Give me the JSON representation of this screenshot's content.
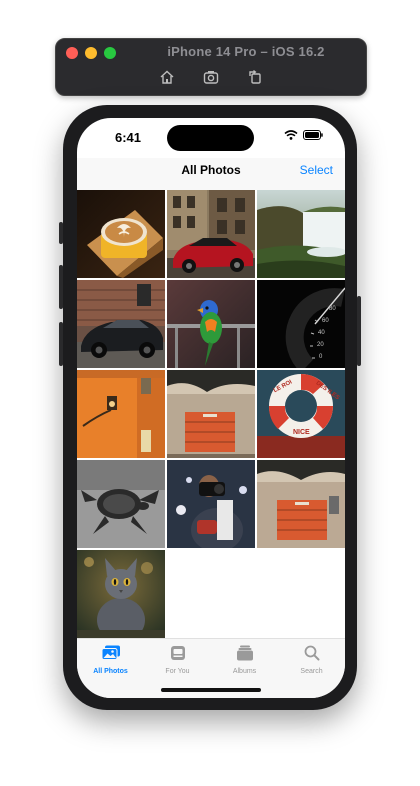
{
  "simulator": {
    "title": "iPhone 14 Pro – iOS 16.2",
    "toolbar_icons": [
      "home-icon",
      "screenshot-icon",
      "rotate-icon"
    ]
  },
  "status_bar": {
    "time": "6:41"
  },
  "nav": {
    "title": "All Photos",
    "select_label": "Select"
  },
  "photos": [
    {
      "name": "latte-art"
    },
    {
      "name": "red-sports-car"
    },
    {
      "name": "waterfall"
    },
    {
      "name": "black-car"
    },
    {
      "name": "parrot"
    },
    {
      "name": "speedometer"
    },
    {
      "name": "orange-wall-lamp"
    },
    {
      "name": "red-door"
    },
    {
      "name": "life-ring"
    },
    {
      "name": "turtle"
    },
    {
      "name": "photographer"
    },
    {
      "name": "red-door-2"
    },
    {
      "name": "gray-cat"
    }
  ],
  "speedo_ticks": [
    "80",
    "60",
    "40",
    "20",
    "0"
  ],
  "lifering_text": [
    "LE ROI",
    "DES ILES",
    "NICE"
  ],
  "tabs": [
    {
      "label": "All Photos",
      "icon": "photos-icon",
      "active": true
    },
    {
      "label": "For You",
      "icon": "for-you-icon",
      "active": false
    },
    {
      "label": "Albums",
      "icon": "albums-icon",
      "active": false
    },
    {
      "label": "Search",
      "icon": "search-icon",
      "active": false
    }
  ],
  "colors": {
    "accent": "#0a84ff",
    "tab_inactive": "#9a9a9a"
  }
}
